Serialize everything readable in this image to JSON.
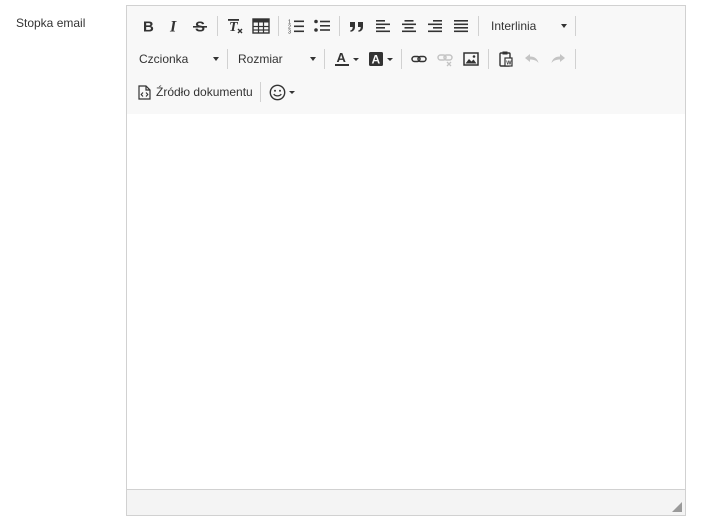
{
  "field": {
    "label": "Stopka email"
  },
  "toolbar": {
    "line_height": {
      "label": "Interlinia"
    },
    "font": {
      "label": "Czcionka"
    },
    "size": {
      "label": "Rozmiar"
    },
    "source": {
      "label": "Źródło dokumentu"
    },
    "icons": [
      "bold-icon",
      "italic-icon",
      "strikethrough-icon",
      "clear-formatting-icon",
      "table-icon",
      "numbered-list-icon",
      "bullet-list-icon",
      "blockquote-icon",
      "align-left-icon",
      "align-center-icon",
      "align-right-icon",
      "justify-icon",
      "text-color-icon",
      "background-color-icon",
      "link-icon",
      "unlink-icon",
      "image-icon",
      "paste-icon",
      "undo-icon",
      "redo-icon",
      "source-icon",
      "emoji-icon"
    ]
  },
  "colors": {
    "toolbar_bg": "#f8f8f8",
    "border": "#d1d1d1",
    "icon": "#333333",
    "icon_disabled": "#c4c4c4"
  }
}
